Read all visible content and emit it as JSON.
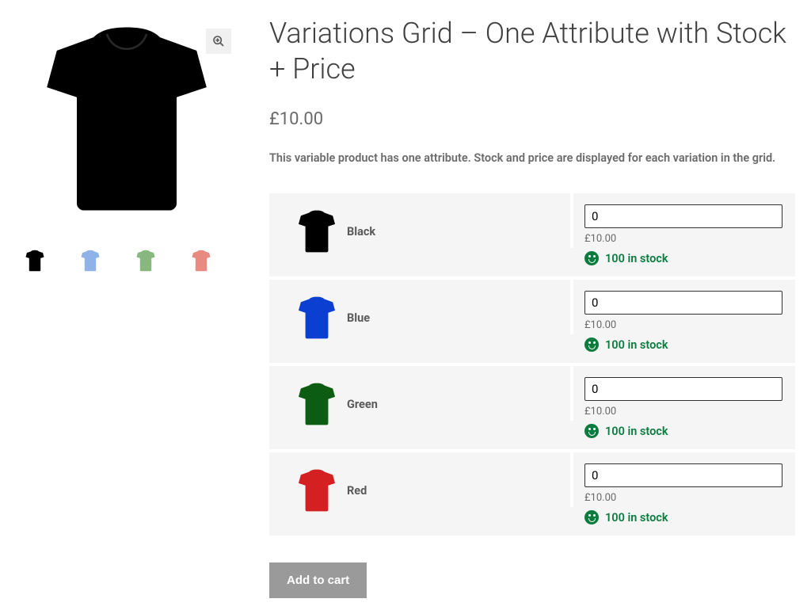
{
  "product": {
    "title": "Variations Grid – One Attribute with Stock + Price",
    "price": "£10.00",
    "description": "This variable product has one attribute. Stock and price are displayed for each variation in the grid."
  },
  "gallery": {
    "main_color": "#000000",
    "thumbs": [
      {
        "color": "#000000",
        "name": "black"
      },
      {
        "color": "#8fb3e8",
        "name": "lightblue"
      },
      {
        "color": "#89b780",
        "name": "green"
      },
      {
        "color": "#e88a82",
        "name": "salmon"
      }
    ]
  },
  "variations": [
    {
      "label": "Black",
      "color": "#000000",
      "qty": "0",
      "price": "£10.00",
      "stock": "100 in stock"
    },
    {
      "label": "Blue",
      "color": "#0a3fd1",
      "qty": "0",
      "price": "£10.00",
      "stock": "100 in stock"
    },
    {
      "label": "Green",
      "color": "#0c5d13",
      "qty": "0",
      "price": "£10.00",
      "stock": "100 in stock"
    },
    {
      "label": "Red",
      "color": "#d42020",
      "qty": "0",
      "price": "£10.00",
      "stock": "100 in stock"
    }
  ],
  "buttons": {
    "add_to_cart": "Add to cart"
  }
}
